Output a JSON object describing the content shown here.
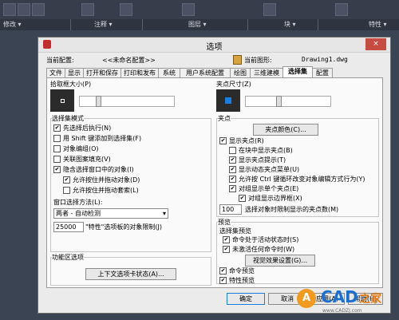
{
  "ribbon": {
    "groups": [
      "修改 ▾",
      "注释 ▾",
      "图层 ▾",
      "块 ▾",
      "特性 ▾"
    ]
  },
  "dialog": {
    "title": "选项",
    "current_profile_label": "当前配置:",
    "current_profile_value": "<<未命名配置>>",
    "current_drawing_label": "当前图形:",
    "current_drawing_value": "Drawing1.dwg",
    "close": "×",
    "tabs": [
      "文件",
      "显示",
      "打开和保存",
      "打印和发布",
      "系统",
      "用户系统配置",
      "绘图",
      "三维建模",
      "选择集",
      "配置"
    ],
    "active_tab": "选择集"
  },
  "left": {
    "pickbox_title": "拾取框大小(P)",
    "selection_modes_title": "选择集模式",
    "modes": [
      {
        "label": "先选择后执行(N)",
        "checked": true
      },
      {
        "label": "用 Shift 键添加到选择集(F)",
        "checked": false
      },
      {
        "label": "对象编组(O)",
        "checked": false
      },
      {
        "label": "关联图案填充(V)",
        "checked": false
      },
      {
        "label": "隐含选择窗口中的对象(I)",
        "checked": true
      },
      {
        "label": "允许按住并拖动对象(D)",
        "checked": true
      },
      {
        "label": "允许按住并拖动套索(L)",
        "checked": false
      }
    ],
    "window_method_label": "窗口选择方法(L):",
    "window_method_value": "两者 - 自动检测",
    "limit_value": "25000",
    "limit_label": "\"特性\"选项板的对象限制(J)",
    "ribbon_options_title": "功能区选项",
    "contextual_tab_button": "上下文选项卡状态(A)..."
  },
  "right": {
    "grip_size_title": "夹点尺寸(Z)",
    "grips_title": "夹点",
    "grip_colors_button": "夹点颜色(C)...",
    "grip_options": [
      {
        "label": "显示夹点(R)",
        "checked": true
      },
      {
        "label": "在块中显示夹点(B)",
        "checked": false
      },
      {
        "label": "显示夹点提示(T)",
        "checked": true
      },
      {
        "label": "显示动态夹点菜单(U)",
        "checked": true
      },
      {
        "label": "允许按 Ctrl 键循环改变对象编辑方式行为(Y)",
        "checked": true
      },
      {
        "label": "对组显示单个夹点(E)",
        "checked": true
      },
      {
        "label": "对组显示边界框(X)",
        "checked": true
      }
    ],
    "grip_limit_value": "100",
    "grip_limit_label": "选择对象时限制显示的夹点数(M)",
    "preview_title": "预览",
    "preview_subtitle": "选择集预览",
    "preview_options": [
      {
        "label": "命令处于活动状态时(S)",
        "checked": true
      },
      {
        "label": "未激活任何命令时(W)",
        "checked": true
      }
    ],
    "visual_effects_button": "视觉效果设置(G)...",
    "extra_options": [
      {
        "label": "命令预览",
        "checked": true
      },
      {
        "label": "特性预览",
        "checked": true
      }
    ]
  },
  "footer": {
    "ok": "确定",
    "cancel": "取消",
    "apply": "应用(A)",
    "help": "帮助(H)"
  },
  "watermark": {
    "text": "CAD",
    "suffix": "之家",
    "url": "www.CADZJ.com"
  },
  "colors": {
    "accent": "#1a7ee0",
    "close": "#c84b43",
    "ribbon_bg": "#2e3440"
  }
}
